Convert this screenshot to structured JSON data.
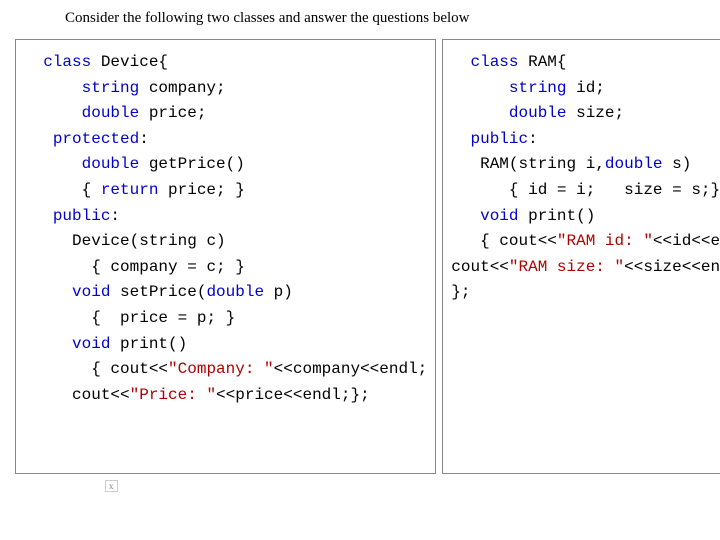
{
  "prompt": "Consider the following two classes and answer the questions below",
  "left": {
    "l1a": "class",
    "l1b": " Device{",
    "l2a": "string",
    "l2b": " company;",
    "l3a": "double",
    "l3b": " price;",
    "l4a": "protected",
    "l4b": ":",
    "l5a": "double",
    "l5b": " getPrice()",
    "l6a": "{ ",
    "l6b": "return",
    "l6c": " price; }",
    "l7a": "public",
    "l7b": ":",
    "l8": "Device(string c)",
    "l9": "{ company = c; }",
    "l10a": "void",
    "l10b": " setPrice(",
    "l10c": "double",
    "l10d": " p)",
    "l11": "{  price = p; }",
    "l12a": "void",
    "l12b": " print()",
    "l13a": "{ cout<<",
    "l13b": "\"Company: \"",
    "l13c": "<<company<<endl;",
    "l14a": "cout<<",
    "l14b": "\"Price: \"",
    "l14c": "<<price<<endl;};"
  },
  "right": {
    "r1a": "class",
    "r1b": " RAM{",
    "r2a": "string",
    "r2b": " id;",
    "r3a": "double",
    "r3b": " size;",
    "r4a": "public",
    "r4b": ":",
    "r5a": "RAM(string i,",
    "r5b": "double",
    "r5c": " s)",
    "r6": "{ id = i;   size = s;}",
    "r7a": "void",
    "r7b": " print()",
    "r8a": "{ cout<<",
    "r8b": "\"RAM id: \"",
    "r8c": "<<id<<endl;",
    "r9a": "cout<<",
    "r9b": "\"RAM size: \"",
    "r9c": "<<size<<endl;}",
    "r10": "};"
  },
  "footnote": "x"
}
